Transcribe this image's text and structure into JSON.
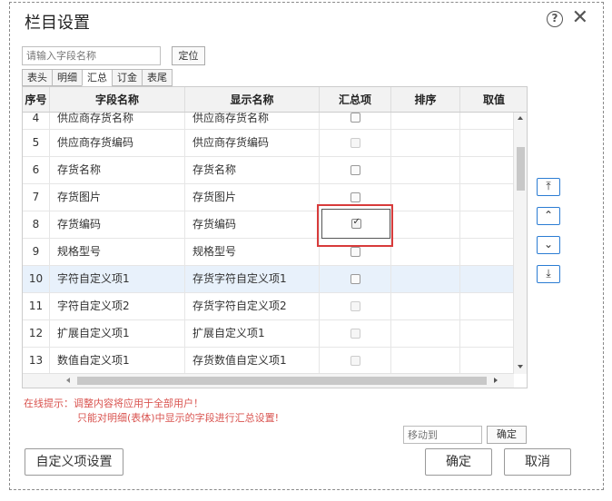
{
  "dialog": {
    "title": "栏目设置",
    "help_glyph": "?",
    "close_glyph": "✕"
  },
  "search": {
    "placeholder": "请输入字段名称",
    "locate_label": "定位"
  },
  "tabs": [
    "表头",
    "明细",
    "汇总",
    "订金",
    "表尾"
  ],
  "active_tab": "汇总",
  "table": {
    "headers": [
      "序号",
      "字段名称",
      "显示名称",
      "汇总项",
      "排序",
      "取值"
    ],
    "rows": [
      {
        "no": "4",
        "field": "供应商存货名称",
        "display": "供应商存货名称",
        "check": "unchecked"
      },
      {
        "no": "5",
        "field": "供应商存货编码",
        "display": "供应商存货编码",
        "check": "disabled"
      },
      {
        "no": "6",
        "field": "存货名称",
        "display": "存货名称",
        "check": "unchecked"
      },
      {
        "no": "7",
        "field": "存货图片",
        "display": "存货图片",
        "check": "unchecked"
      },
      {
        "no": "8",
        "field": "存货编码",
        "display": "存货编码",
        "check": "checked"
      },
      {
        "no": "9",
        "field": "规格型号",
        "display": "规格型号",
        "check": "unchecked"
      },
      {
        "no": "10",
        "field": "字符自定义项1",
        "display": "存货字符自定义项1",
        "check": "unchecked"
      },
      {
        "no": "11",
        "field": "字符自定义项2",
        "display": "存货字符自定义项2",
        "check": "disabled"
      },
      {
        "no": "12",
        "field": "扩展自定义项1",
        "display": "扩展自定义项1",
        "check": "disabled"
      },
      {
        "no": "13",
        "field": "数值自定义项1",
        "display": "存货数值自定义项1",
        "check": "disabled"
      }
    ]
  },
  "side_buttons": [
    "⤒",
    "⌃",
    "⌄",
    "⤓"
  ],
  "tips": {
    "line1": "在线提示：调整内容将应用于全部用户！",
    "line2": "只能对明细(表体)中显示的字段进行汇总设置!"
  },
  "move": {
    "placeholder": "移动到",
    "confirm_label": "确定"
  },
  "footer": {
    "custom_label": "自定义项设置",
    "ok_label": "确定",
    "cancel_label": "取消"
  },
  "colors": {
    "highlight": "#d83b3b",
    "accent": "#2b7cd3",
    "tip": "#d9534f",
    "selected_row": "#e8f1fb"
  }
}
